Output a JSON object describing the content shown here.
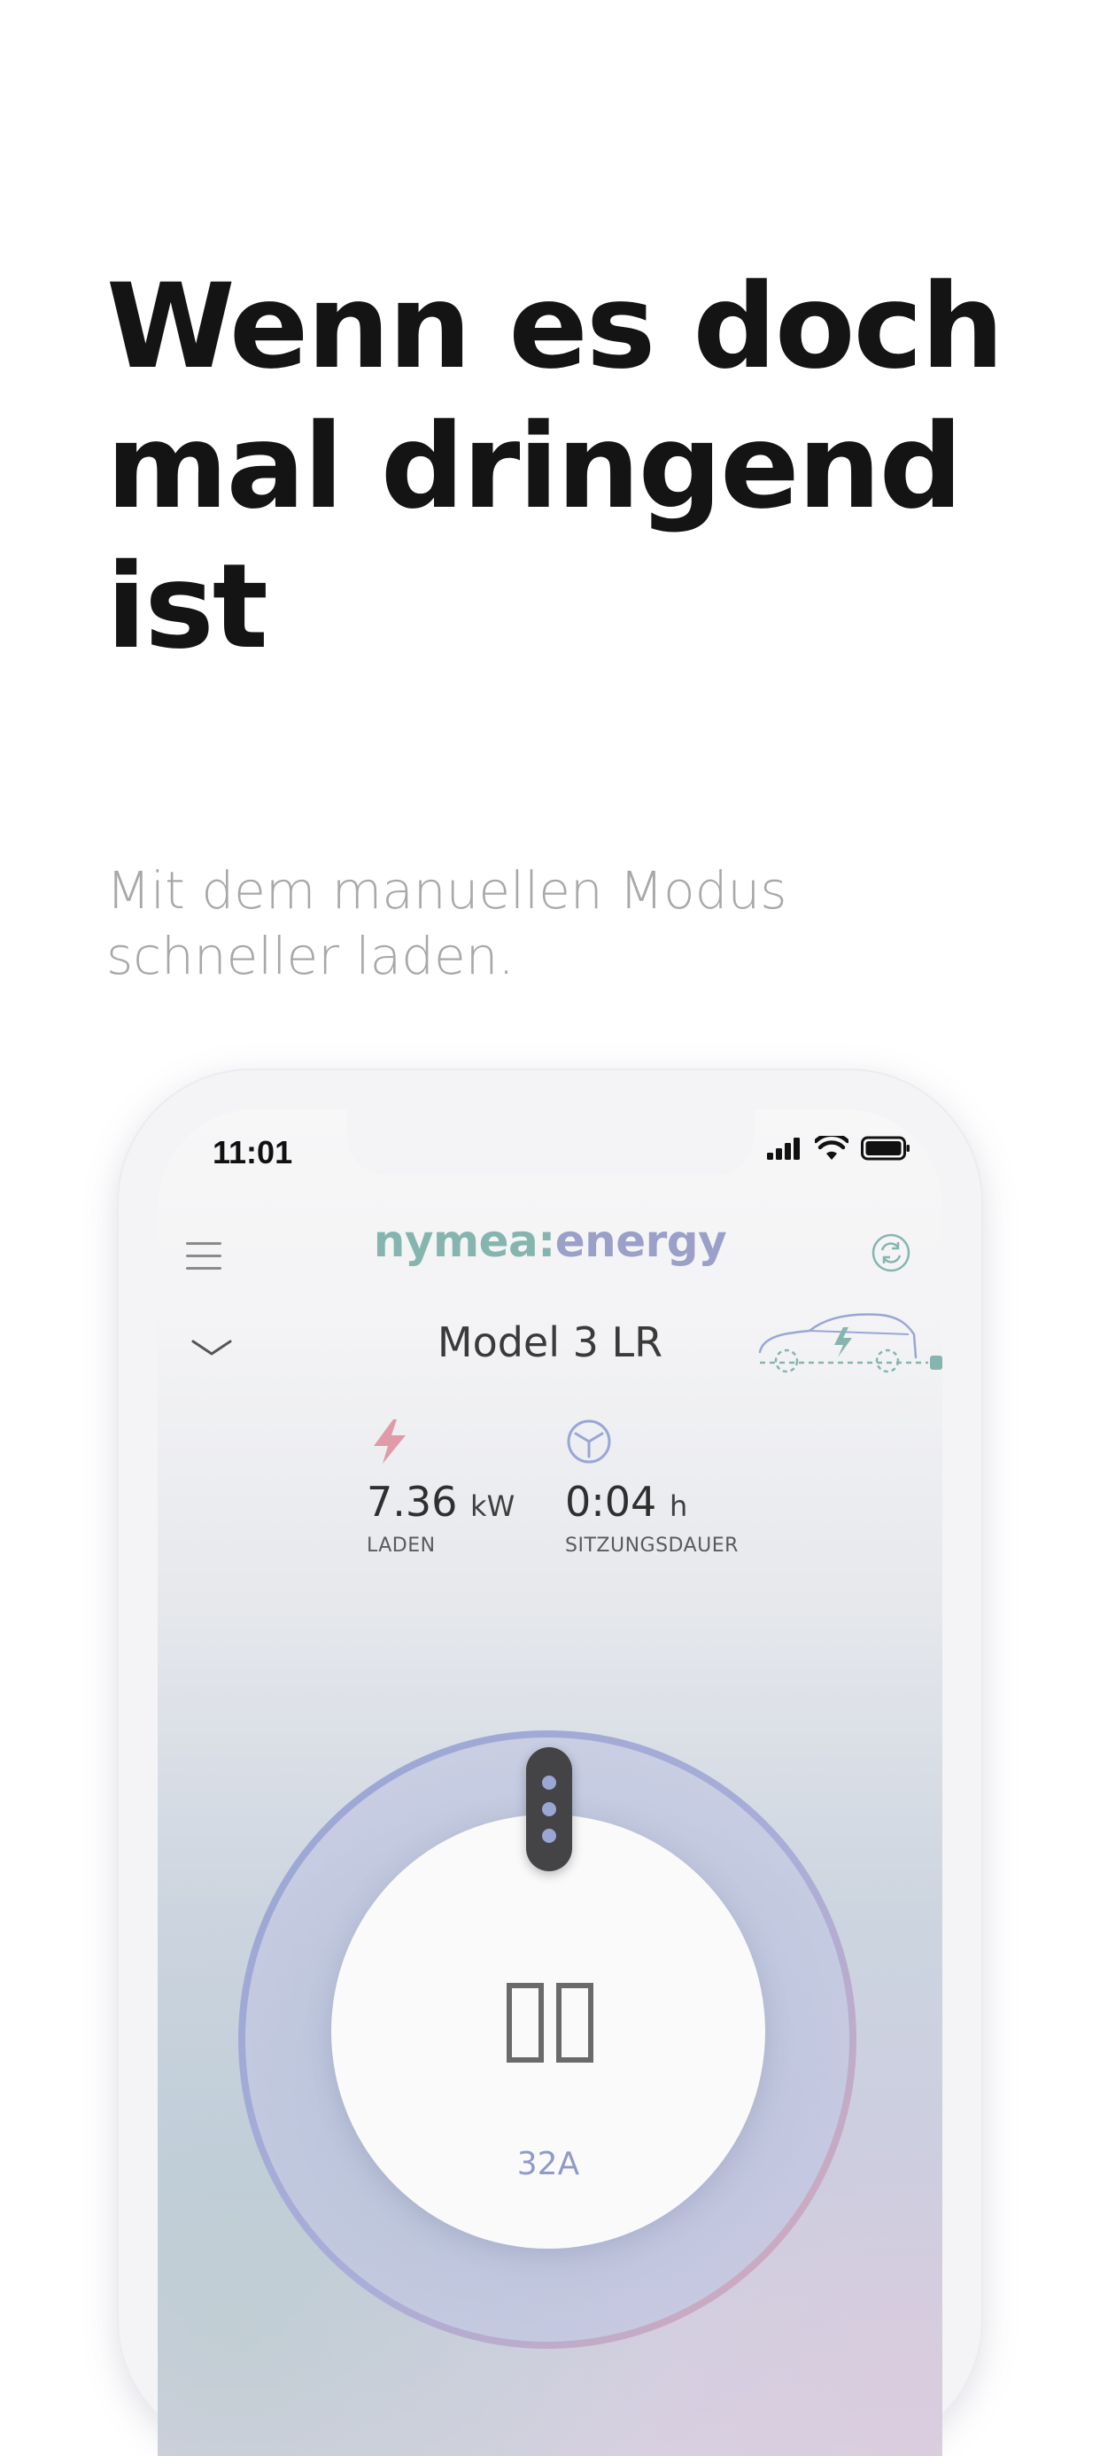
{
  "headline": {
    "line1": "Wenn es doch",
    "line2": "mal dringend",
    "line3": "ist"
  },
  "subline": {
    "line1": "Mit dem manuellen Modus",
    "line2": "schneller laden."
  },
  "phone": {
    "status_bar": {
      "time": "11:01",
      "icons": [
        "cellular-signal-icon",
        "wifi-icon",
        "battery-icon"
      ]
    },
    "header": {
      "logo_part1": "nymea:",
      "logo_part2": "energy",
      "menu_icon": "hamburger-menu-icon",
      "sync_icon": "sync-icon"
    },
    "vehicle": {
      "name": "Model 3 LR",
      "expand_icon": "chevron-down-icon",
      "car_icon": "car-charging-icon"
    },
    "stats": {
      "charge_value": "7.36",
      "charge_unit": "kW",
      "charge_label": "LADEN",
      "session_value": "0:04",
      "session_unit": "h",
      "session_label": "SITZUNGSDAUER"
    },
    "dial": {
      "action_icon": "pause-icon",
      "current_label": "32A"
    },
    "colors": {
      "logo_teal": "#86b5b0",
      "logo_lavender": "#9aa0c8",
      "lightning": "#e09aa8",
      "dial_blue": "#9aa6d4",
      "dial_pink": "#d9a8b8"
    }
  }
}
